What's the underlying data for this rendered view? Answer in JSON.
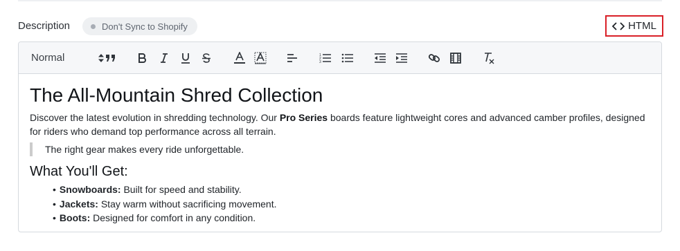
{
  "header": {
    "description_label": "Description",
    "sync_badge": "Don't Sync to Shopify",
    "html_button": "HTML"
  },
  "toolbar": {
    "format_select": "Normal",
    "buttons": [
      "blockquote",
      "bold",
      "italic",
      "underline",
      "strikethrough",
      "font-color",
      "background-color",
      "align",
      "ordered-list",
      "bullet-list",
      "outdent",
      "indent",
      "link",
      "video",
      "clear-formatting"
    ]
  },
  "content": {
    "heading": "The All-Mountain Shred Collection",
    "paragraph_before": "Discover the latest evolution in shredding technology. Our ",
    "paragraph_bold": "Pro Series",
    "paragraph_after": " boards feature lightweight cores and advanced camber profiles, designed for riders who demand top performance across all terrain.",
    "quote": "The right gear makes every ride unforgettable.",
    "subheading": "What You'll Get:",
    "items": [
      {
        "bullet": "•",
        "term": "Snowboards:",
        "text": " Built for speed and stability."
      },
      {
        "bullet": "•",
        "term": "Jackets:",
        "text": " Stay warm without sacrificing movement."
      },
      {
        "bullet": "•",
        "term": "Boots:",
        "text": " Designed for comfort in any condition."
      }
    ]
  }
}
